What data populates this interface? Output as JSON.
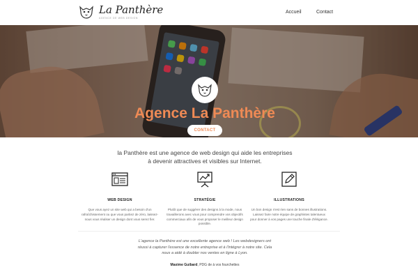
{
  "header": {
    "logo_title": "La Panthère",
    "logo_subtitle": "agence de web design",
    "nav": [
      {
        "label": "Accueil"
      },
      {
        "label": "Contact"
      }
    ]
  },
  "hero": {
    "title": "Agence La Panthère",
    "button_label": "CONTACT"
  },
  "intro": {
    "line1": "la Panthère est une agence de web design qui aide les entreprises",
    "line2": "à devenir attractives et visibles sur Internet."
  },
  "features": [
    {
      "icon": "browser-window-icon",
      "title": "WEB DESIGN",
      "text": "Que vous ayez un site web qui a besoin d'un rafraîchissement ou que vous partiez de zéro, laissez-nous vous réaliser un design dont vous serez fier."
    },
    {
      "icon": "chart-board-icon",
      "title": "STRATÉGIE",
      "text": "Plutôt que de suggérer des designs à la mode, nous travaillerons avec vous pour comprendre vos objectifs commerciaux afin de vous proposer le meilleur design possible."
    },
    {
      "icon": "pencil-icon",
      "title": "ILLUSTRATIONS",
      "text": "Un bon design n'est rien sans de bonnes illustrations. Laissez faire notre équipe de graphistes talentueux pour donner à vos pages une touche finale d'élégance."
    }
  ],
  "testimonial": {
    "quote_line1": "L'agence la Panthère est une excellente agence web ! Les webdesigners ont",
    "quote_line2": "réussi à capturer l'essence de notre entreprise et à l'intégrer à notre site. Cela",
    "quote_line3": "nous a aidé à doubler nos ventes en ligne à Lyon.",
    "author_name": "Maxime Guibard",
    "author_role": ", PDG de à vos fourchettes"
  },
  "colors": {
    "accent": "#ef8a55",
    "text": "#333333"
  }
}
